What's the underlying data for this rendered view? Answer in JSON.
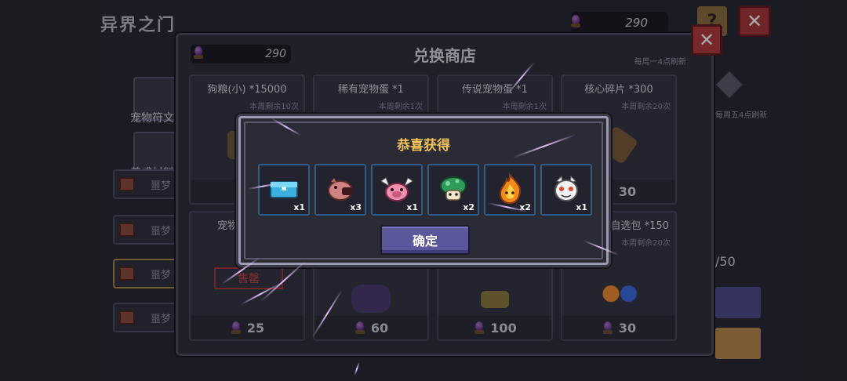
{
  "background": {
    "title": "异界之门",
    "currency": "290",
    "help_label": "?",
    "close_label": "✕",
    "side_items": [
      "宠物符文",
      "养成材料"
    ],
    "tabs": [
      "噩梦",
      "噩梦",
      "噩梦",
      "噩梦"
    ],
    "right_refresh": "每周五4点刷新",
    "right_progress": "/50"
  },
  "shop": {
    "title": "兑换商店",
    "currency": "290",
    "refresh_note": "每周一4点刷新",
    "close_label": "✕",
    "cards": [
      {
        "name": "狗粮(小) *15000",
        "limit": "本周剩余10次",
        "price": ""
      },
      {
        "name": "稀有宠物蛋 *1",
        "limit": "本周剩余1次",
        "price": ""
      },
      {
        "name": "传说宠物蛋 *1",
        "limit": "本周剩余1次",
        "price": ""
      },
      {
        "name": "核心碎片 *300",
        "limit": "本周剩余20次",
        "price": "30"
      },
      {
        "name": "宠物",
        "limit": "",
        "price": "25",
        "status": "售罄"
      },
      {
        "name": "",
        "limit": "",
        "price": "60"
      },
      {
        "name": "",
        "limit": "",
        "price": "100"
      },
      {
        "name": "自选包 *150",
        "limit": "本周剩余20次",
        "price": "30"
      }
    ]
  },
  "reward": {
    "title": "恭喜获得",
    "confirm_label": "确定",
    "items": [
      {
        "icon": "ice-chest-icon",
        "qty": "x1"
      },
      {
        "icon": "pig-pet-icon",
        "qty": "x3"
      },
      {
        "icon": "winged-pig-pet-icon",
        "qty": "x1"
      },
      {
        "icon": "green-mushroom-pet-icon",
        "qty": "x2"
      },
      {
        "icon": "fire-spirit-pet-icon",
        "qty": "x2"
      },
      {
        "icon": "white-ghost-pet-icon",
        "qty": "x1"
      }
    ]
  },
  "colors": {
    "title_gold": "#f0c259",
    "item_border": "#2e5d8a",
    "confirm_button": "#5a579a",
    "close_red": "#b33a3a"
  }
}
